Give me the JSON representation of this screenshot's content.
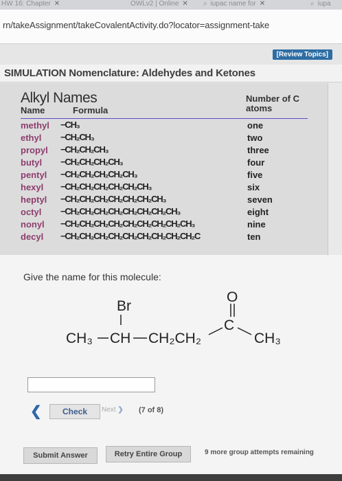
{
  "browser": {
    "tabs": [
      {
        "label": "HW 16: Chapter"
      },
      {
        "label": "OWLv2 | Online"
      },
      {
        "label": "iupac name for"
      },
      {
        "label": "iupa"
      }
    ],
    "url": "rn/takeAssignment/takeCovalentActivity.do?locator=assignment-take"
  },
  "header": {
    "review_topics": "[Review Topics]",
    "sim_prefix": "SIMULATION",
    "sim_title": "Nomenclature: Aldehydes and Ketones"
  },
  "alkyl_table": {
    "title": "Alkyl Names",
    "col_name": "Name",
    "col_formula": "Formula",
    "col_number": "Number of C atoms",
    "rows": [
      {
        "name": "methyl",
        "formula": "−CH₃",
        "number": "one"
      },
      {
        "name": "ethyl",
        "formula": "−CH₂CH₃",
        "number": "two"
      },
      {
        "name": "propyl",
        "formula": "−CH₂CH₂CH₃",
        "number": "three"
      },
      {
        "name": "butyl",
        "formula": "−CH₂CH₂CH₂CH₃",
        "number": "four"
      },
      {
        "name": "pentyl",
        "formula": "−CH₂CH₂CH₂CH₂CH₃",
        "number": "five"
      },
      {
        "name": "hexyl",
        "formula": "−CH₂CH₂CH₂CH₂CH₂CH₃",
        "number": "six"
      },
      {
        "name": "heptyl",
        "formula": "−CH₂CH₂CH₂CH₂CH₂CH₂CH₃",
        "number": "seven"
      },
      {
        "name": "octyl",
        "formula": "−CH₂CH₂CH₂CH₂CH₂CH₂CH₂CH₃",
        "number": "eight"
      },
      {
        "name": "nonyl",
        "formula": "−CH₂CH₂CH₂CH₂CH₂CH₂CH₂CH₂CH₃",
        "number": "nine"
      },
      {
        "name": "decyl",
        "formula": "−CH₂CH₂CH₂CH₂CH₂CH₂CH₂CH₂CH₂C",
        "number": "ten"
      }
    ]
  },
  "question": {
    "prompt": "Give the name for this molecule:",
    "molecule": {
      "br": "Br",
      "o": "O",
      "c": "C",
      "ch3_left": "CH₃",
      "ch": "CH",
      "ch2ch2": "CH₂CH₂",
      "ch3_right": "CH₃"
    },
    "answer_value": ""
  },
  "nav": {
    "check": "Check",
    "next": "Next",
    "progress": "(7 of 8)"
  },
  "footer": {
    "submit": "Submit Answer",
    "retry": "Retry Entire Group",
    "remaining": "9 more group attempts remaining"
  }
}
